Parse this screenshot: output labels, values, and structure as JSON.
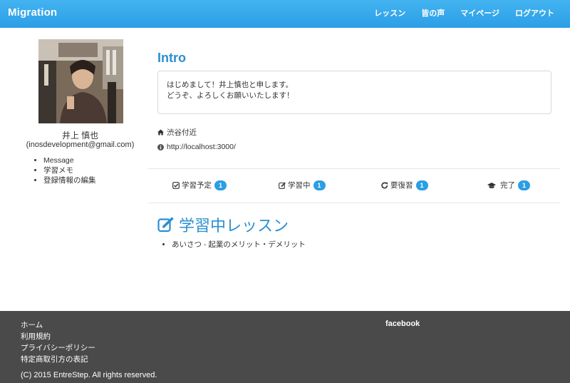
{
  "navbar": {
    "brand": "Migration",
    "links": [
      "レッスン",
      "皆の声",
      "マイページ",
      "ログアウト"
    ]
  },
  "profile": {
    "name": "井上 慎也",
    "email": "(inosdevelopment@gmail.com)",
    "links": [
      "Message",
      "学習メモ",
      "登録情報の編集"
    ]
  },
  "intro": {
    "title": "Intro",
    "line1": "はじめまして！井上慎也と申します。",
    "line2": "どうぞ、よろしくお願いいたします！"
  },
  "meta": {
    "location": "渋谷付近",
    "url": "http://localhost:3000/"
  },
  "stats": [
    {
      "label": "学習予定",
      "count": "1",
      "icon": "check-square-icon"
    },
    {
      "label": "学習中",
      "count": "1",
      "icon": "edit-icon"
    },
    {
      "label": "要復習",
      "count": "1",
      "icon": "refresh-icon"
    },
    {
      "label": "完了",
      "count": "1",
      "icon": "graduation-cap-icon"
    }
  ],
  "current_section": {
    "title": "学習中レッスン",
    "lessons": [
      "あいさつ - 起業のメリット・デメリット"
    ]
  },
  "footer": {
    "links": [
      "ホーム",
      "利用規約",
      "プライバシーポリシー",
      "特定商取引方の表記"
    ],
    "social": "facebook",
    "copyright": "(C) 2015 EntreStep. All rights reserved."
  },
  "colors": {
    "navbar": "#2b9ee6",
    "accent": "#2a8fd0",
    "badge": "#2a9fe4",
    "footer": "#4a4a4a"
  }
}
